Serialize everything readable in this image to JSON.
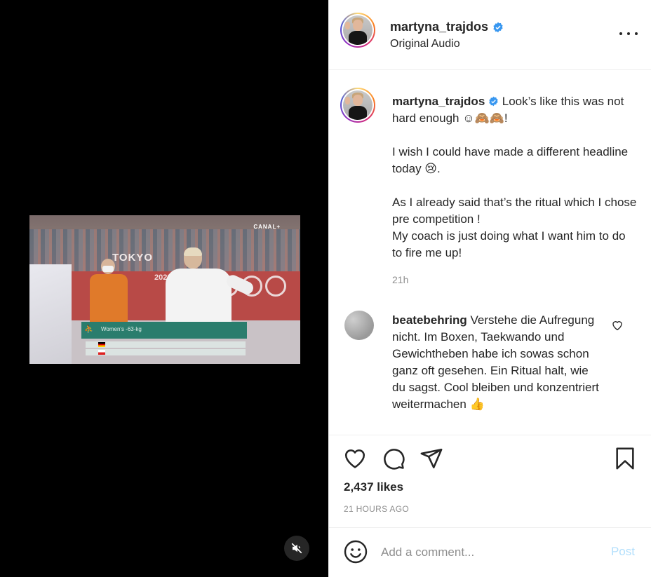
{
  "post": {
    "username": "martyna_trajdos",
    "audio": "Original Audio",
    "verified_color": "#3897f0"
  },
  "caption": {
    "username": "martyna_trajdos",
    "line1": "Look’s like this was not hard enough ☺🙈🙈!",
    "line2": "I wish I could have made a different headline today 😢.",
    "line3": "As I already said that’s the ritual which I chose pre competition !",
    "line4": "My coach is just doing what I want him to do to fire me up!",
    "time": "21h"
  },
  "comment": {
    "username": "beatebehring",
    "text": "Verstehe die Aufregung nicht. Im Boxen, Taekwando und Gewichtheben habe ich sowas schon ganz oft gesehen. Ein Ritual halt, wie du sagst. Cool bleiben und konzentriert weitermachen 👍"
  },
  "stats": {
    "likes": "2,437 likes",
    "time_ago": "21 HOURS AGO"
  },
  "composer": {
    "placeholder": "Add a comment...",
    "post_label": "Post"
  },
  "video": {
    "overlay_text": "Women's -63-kg",
    "venue_text": "TOKYO",
    "venue_text2": "2020",
    "broadcaster": "CANAL+"
  },
  "icons": {
    "more": "more-options-icon",
    "like": "heart-icon",
    "comment": "comment-icon",
    "share": "share-icon",
    "save": "bookmark-icon",
    "emoji": "emoji-icon",
    "mute": "muted-speaker-icon"
  }
}
